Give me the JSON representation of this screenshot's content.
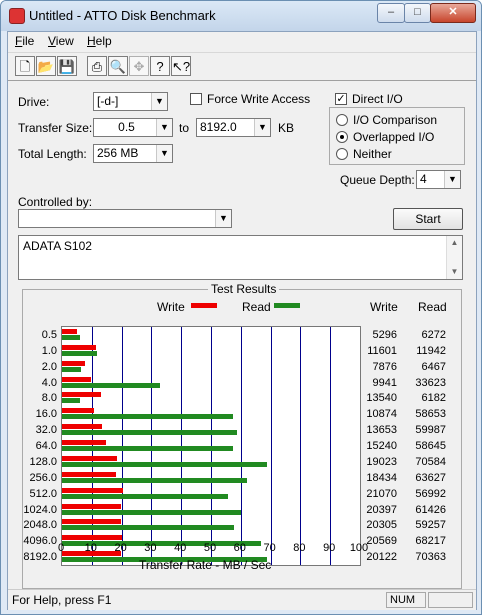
{
  "window": {
    "title": "Untitled - ATTO Disk Benchmark",
    "minimize": "–",
    "maximize": "□",
    "close": "✕"
  },
  "menu": {
    "file": "File",
    "view": "View",
    "help": "Help"
  },
  "toolbar_icons": [
    "new-icon",
    "open-icon",
    "save-icon",
    "print-icon",
    "print-preview-icon",
    "move-icon",
    "help-icon",
    "context-help-icon"
  ],
  "form": {
    "drive_label": "Drive:",
    "drive_value": "[-d-]",
    "force_write_label": "Force Write Access",
    "direct_io_label": "Direct I/O",
    "direct_io_checked": true,
    "transfer_size_label": "Transfer Size:",
    "transfer_from": "0.5",
    "to_label": "to",
    "transfer_to": "8192.0",
    "kb_label": "KB",
    "total_length_label": "Total Length:",
    "total_length_value": "256 MB",
    "io_comparison_label": "I/O Comparison",
    "overlapped_io_label": "Overlapped I/O",
    "neither_label": "Neither",
    "selected_mode": "Overlapped I/O",
    "queue_depth_label": "Queue Depth:",
    "queue_depth_value": "4",
    "controlled_by_label": "Controlled by:",
    "controlled_by_value": "",
    "start_label": "Start",
    "description_text": "ADATA S102"
  },
  "results": {
    "group_title": "Test Results",
    "legend_write": "Write",
    "legend_read": "Read",
    "col_write": "Write",
    "col_read": "Read",
    "xlabel": "Transfer Rate - MB / Sec"
  },
  "chart_data": {
    "type": "bar",
    "orientation": "horizontal",
    "categories": [
      "0.5",
      "1.0",
      "2.0",
      "4.0",
      "8.0",
      "16.0",
      "32.0",
      "64.0",
      "128.0",
      "256.0",
      "512.0",
      "1024.0",
      "2048.0",
      "4096.0",
      "8192.0"
    ],
    "series": [
      {
        "name": "Write",
        "color": "#ee0000",
        "values": [
          5296,
          11601,
          7876,
          9941,
          13540,
          10874,
          13653,
          15240,
          19023,
          18434,
          21070,
          20397,
          20305,
          20569,
          20122
        ]
      },
      {
        "name": "Read",
        "color": "#218a21",
        "values": [
          6272,
          11942,
          6467,
          33623,
          6182,
          58653,
          59987,
          58645,
          70584,
          63627,
          56992,
          61426,
          59257,
          68217,
          70363
        ]
      }
    ],
    "values_unit": "KB/s",
    "xlabel": "Transfer Rate - MB / Sec",
    "xlim": [
      0,
      100
    ],
    "xticks": [
      "0",
      "10",
      "20",
      "30",
      "40",
      "50",
      "60",
      "70",
      "80",
      "90",
      "100"
    ],
    "grid": true,
    "legend": "top"
  },
  "status": {
    "text": "For Help, press F1",
    "num": "NUM"
  }
}
